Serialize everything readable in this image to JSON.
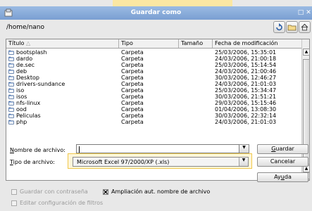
{
  "window": {
    "title": "Guardar como"
  },
  "location": {
    "path": "/home/nano"
  },
  "columns": {
    "title": "Título",
    "type": "Tipo",
    "size": "Tamaño",
    "modified": "Fecha de modificación"
  },
  "files": [
    {
      "name": "bootsplash",
      "type": "Carpeta",
      "size": "",
      "modified": "25/03/2006, 15:35:01"
    },
    {
      "name": "dardo",
      "type": "Carpeta",
      "size": "",
      "modified": "24/03/2006, 21:00:18"
    },
    {
      "name": "de.sec",
      "type": "Carpeta",
      "size": "",
      "modified": "25/03/2006, 15:14:54"
    },
    {
      "name": "deb",
      "type": "Carpeta",
      "size": "",
      "modified": "24/03/2006, 21:00:46"
    },
    {
      "name": "Desktop",
      "type": "Carpeta",
      "size": "",
      "modified": "30/03/2006, 12:46:27"
    },
    {
      "name": "drivers-sundance",
      "type": "Carpeta",
      "size": "",
      "modified": "24/03/2006, 21:01:03"
    },
    {
      "name": "iso",
      "type": "Carpeta",
      "size": "",
      "modified": "25/03/2006, 15:34:47"
    },
    {
      "name": "isos",
      "type": "Carpeta",
      "size": "",
      "modified": "30/03/2006, 21:51:21"
    },
    {
      "name": "nfs-linux",
      "type": "Carpeta",
      "size": "",
      "modified": "29/03/2006, 15:15:46"
    },
    {
      "name": "ood",
      "type": "Carpeta",
      "size": "",
      "modified": "01/04/2006, 13:08:30"
    },
    {
      "name": "Peliculas",
      "type": "Carpeta",
      "size": "",
      "modified": "30/03/2006, 22:32:14"
    },
    {
      "name": "php",
      "type": "Carpeta",
      "size": "",
      "modified": "24/03/2006, 21:01:03"
    }
  ],
  "form": {
    "filename_label": "Nombre de archivo:",
    "filename_value": "",
    "filetype_label": "Tipo de archivo:",
    "filetype_value": "Microsoft Excel 97/2000/XP (.xls)"
  },
  "buttons": {
    "save": "Guardar",
    "cancel": "Cancelar",
    "help": "Ayuda"
  },
  "options": {
    "password_label": "Guardar con contraseña",
    "password_checked": false,
    "extension_label": "Ampliación aut. nombre de archivo",
    "extension_checked": true,
    "filter_label": "Editar configuración de filtros",
    "filter_checked": false
  },
  "colors": {
    "titlebar": "#7a9fd2",
    "highlight": "#f6c85e",
    "folder": "#5b87c8"
  },
  "icons": {
    "up": "up-folder-icon",
    "new_folder": "new-folder-icon",
    "home": "home-icon"
  }
}
